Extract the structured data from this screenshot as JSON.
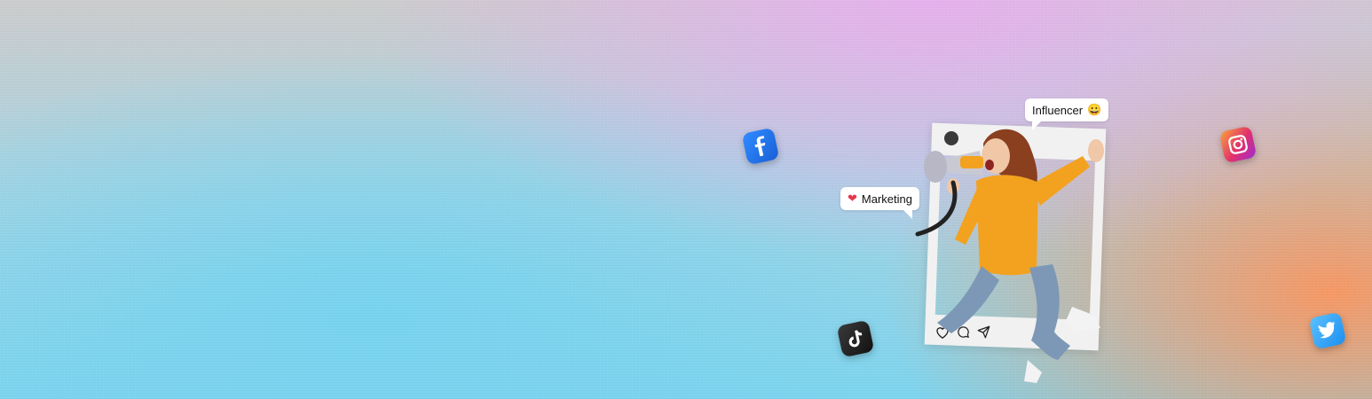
{
  "bubbles": {
    "influencer": {
      "label": "Influencer",
      "emoji": "😀"
    },
    "marketing": {
      "label": "Marketing",
      "emoji": "❤"
    }
  },
  "icons": {
    "facebook": "facebook-icon",
    "instagram": "instagram-icon",
    "tiktok": "tiktok-icon",
    "twitter": "twitter-icon",
    "like": "heart-outline-icon",
    "comment": "comment-icon",
    "share": "send-icon"
  },
  "colors": {
    "facebook": "#1a5fd6",
    "instagram": "#e1306c",
    "tiktok": "#111111",
    "twitter": "#1d8ff0",
    "heart": "#e53950"
  }
}
